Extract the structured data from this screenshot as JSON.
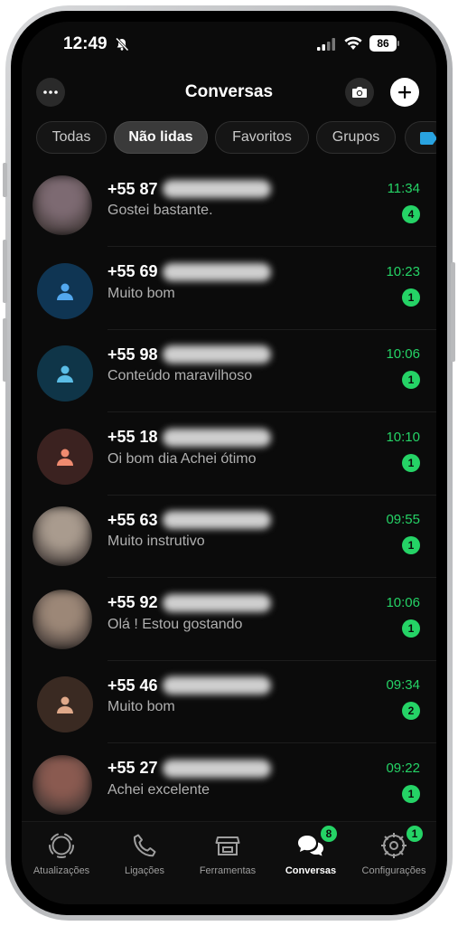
{
  "status_bar": {
    "time": "12:49",
    "battery": "86"
  },
  "header": {
    "title": "Conversas"
  },
  "filters": [
    {
      "label": "Todas",
      "active": false
    },
    {
      "label": "Não lidas",
      "active": true
    },
    {
      "label": "Favoritos",
      "active": false
    },
    {
      "label": "Grupos",
      "active": false
    }
  ],
  "chats": [
    {
      "name": "+55 87",
      "preview": "Gostei bastante.",
      "time": "11:34",
      "unread": "4",
      "avatar": "photo",
      "tone": "#7d6a72"
    },
    {
      "name": "+55 69",
      "preview": "Muito bom",
      "time": "10:23",
      "unread": "1",
      "avatar": "default-blue"
    },
    {
      "name": "+55 98",
      "preview": "Conteúdo maravilhoso",
      "time": "10:06",
      "unread": "1",
      "avatar": "default-teal"
    },
    {
      "name": "+55 18",
      "preview": "Oi bom dia  Achei ótimo",
      "time": "10:10",
      "unread": "1",
      "avatar": "default-coral"
    },
    {
      "name": "+55 63",
      "preview": "Muito instrutivo",
      "time": "09:55",
      "unread": "1",
      "avatar": "photo",
      "tone": "#a99b8e"
    },
    {
      "name": "+55 92",
      "preview": "Olá ! Estou gostando",
      "time": "10:06",
      "unread": "1",
      "avatar": "photo",
      "tone": "#9c8777"
    },
    {
      "name": "+55 46",
      "preview": "Muito bom",
      "time": "09:34",
      "unread": "2",
      "avatar": "default-tan"
    },
    {
      "name": "+55 27",
      "preview": "Achei excelente",
      "time": "09:22",
      "unread": "1",
      "avatar": "photo",
      "tone": "#8a5a50"
    }
  ],
  "bottom_nav": [
    {
      "label": "Atualizações",
      "icon": "updates-icon",
      "badge": ""
    },
    {
      "label": "Ligações",
      "icon": "phone-icon",
      "badge": ""
    },
    {
      "label": "Ferramentas",
      "icon": "store-icon",
      "badge": ""
    },
    {
      "label": "Conversas",
      "icon": "chats-icon",
      "badge": "8",
      "active": true
    },
    {
      "label": "Configurações",
      "icon": "settings-icon",
      "badge": "1"
    }
  ],
  "colors": {
    "accent": "#25d366",
    "background": "#0b0b0b"
  }
}
